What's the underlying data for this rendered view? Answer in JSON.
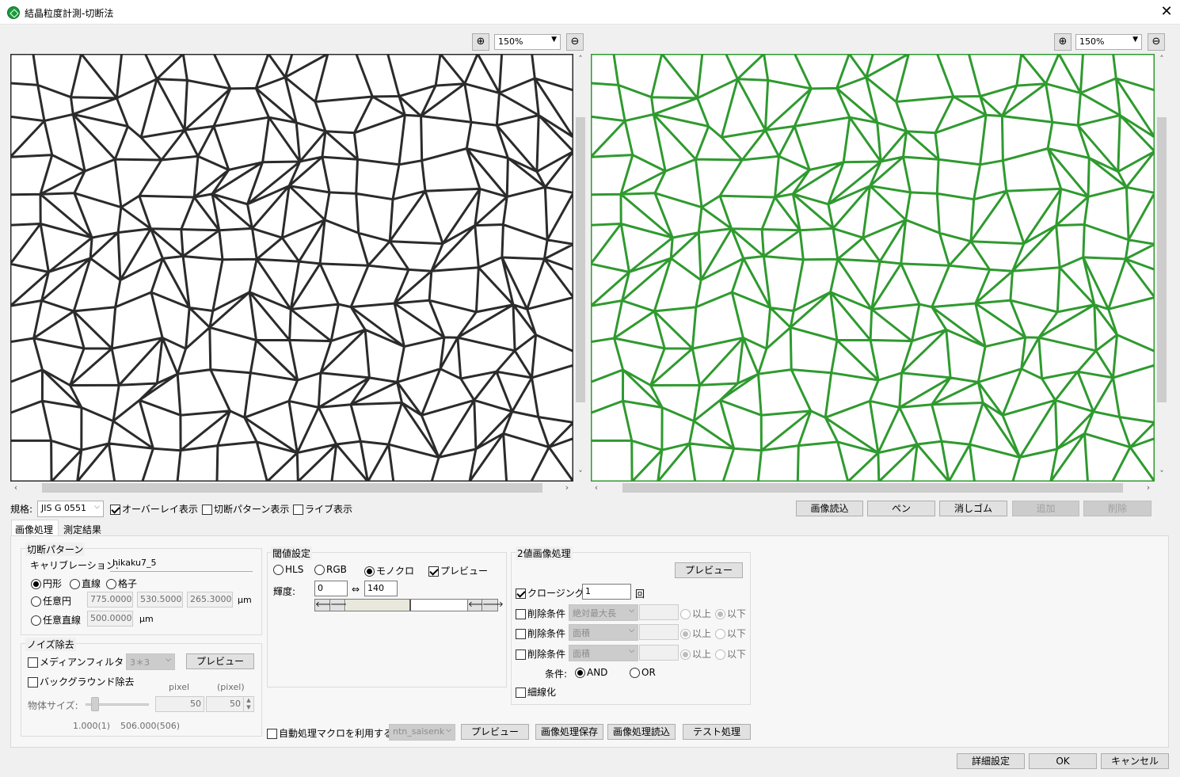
{
  "window": {
    "title": "結晶粒度計測-切断法",
    "close": "✕"
  },
  "left_view": {
    "zoom": "150%"
  },
  "right_view": {
    "zoom": "150%"
  },
  "toolbar": {
    "standard_label": "規格:",
    "standard_value": "JIS G 0551",
    "overlay_label": "オーバーレイ表示",
    "overlay_checked": true,
    "pattern_label": "切断パターン表示",
    "live_label": "ライブ表示",
    "btn_load_image": "画像読込",
    "btn_pen": "ペン",
    "btn_eraser": "消しゴム",
    "btn_add": "追加",
    "btn_delete": "削除"
  },
  "tabs": [
    "画像処理",
    "測定結果"
  ],
  "cut_pattern": {
    "title": "切断パターン",
    "calibration_label": "キャリブレーション:",
    "calibration_value": "hikaku7_5",
    "circle": "円形",
    "line": "直線",
    "grid": "格子",
    "arbitrary_circle": "任意円",
    "circle_values": [
      "775.00000",
      "530.50000",
      "265.30000"
    ],
    "unit": "μm",
    "arbitrary_line": "任意直線",
    "line_value": "500.00000",
    "unit2": "μm"
  },
  "noise": {
    "title": "ノイズ除去",
    "median_label": "メディアンフィルタ",
    "median_size": "3＊3",
    "preview": "プレビュー",
    "background_label": "バックグラウンド除去",
    "pixel_head1": "pixel",
    "pixel_head2": "(pixel)",
    "object_size_label": "物体サイズ:",
    "val1": "50",
    "val2": "50",
    "min_label": "1.000(1)",
    "max_label": "506.000(506)"
  },
  "threshold": {
    "title": "閾値設定",
    "hls": "HLS",
    "rgb": "RGB",
    "mono": "モノクロ",
    "preview_label": "プレビュー",
    "brightness_label": "輝度:",
    "low": "0",
    "arrow": "⇔",
    "high": "140"
  },
  "binary": {
    "title": "2値画像処理",
    "preview": "プレビュー",
    "closing_label": "クロージング",
    "closing_value": "1",
    "times": "回",
    "delete_cond": "削除条件",
    "cond1": "絶対最大長",
    "cond2": "面積",
    "cond3": "面積",
    "above": "以上",
    "below": "以下",
    "condition_label": "条件:",
    "and": "AND",
    "or": "OR",
    "thinning": "細線化"
  },
  "macro": {
    "label": "自動処理マクロを利用する",
    "value": "ntn_saisenk",
    "preview": "プレビュー",
    "save": "画像処理保存",
    "load": "画像処理読込",
    "test": "テスト処理"
  },
  "footer": {
    "detail": "詳細設定",
    "ok": "OK",
    "cancel": "キャンセル"
  },
  "colors": {
    "grain_boundary_left": "#2b2b2b",
    "grain_boundary_right": "#2f9a2f"
  }
}
